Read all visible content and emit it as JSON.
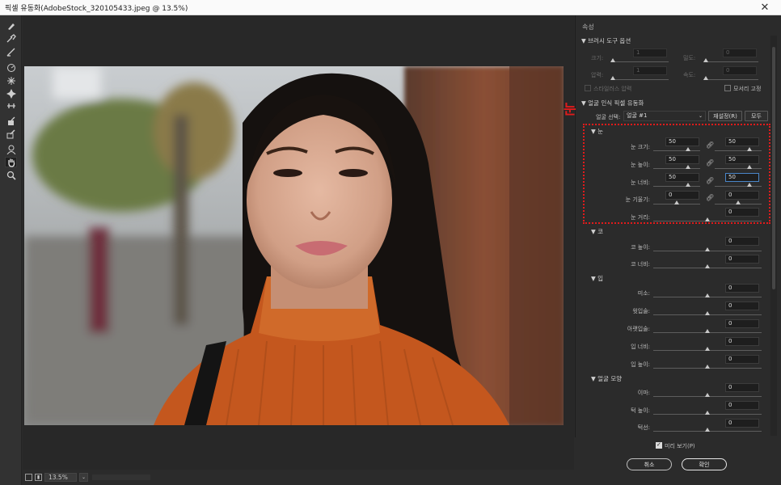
{
  "window": {
    "title": "픽셀 유동화(AdobeStock_320105433.jpeg @ 13.5%)",
    "close_glyph": "✕"
  },
  "tools": [
    "forward-warp-icon",
    "reconstruct-icon",
    "smooth-icon",
    "twirl-icon",
    "pucker-icon",
    "bloat-icon",
    "push-left-icon",
    "freeze-mask-icon",
    "thaw-mask-icon",
    "face-tool-icon",
    "hand-icon",
    "zoom-icon"
  ],
  "status": {
    "zoom": "13.5%"
  },
  "panel": {
    "header": "속성",
    "brush": {
      "title": "▼ 브러시 도구 옵션",
      "size_label": "크기:",
      "size_value": "1",
      "density_label": "밀도:",
      "density_value": "0",
      "pressure_label": "압력:",
      "pressure_value": "1",
      "rate_label": "속도:",
      "rate_value": "0",
      "stylus_label": "스타일러스 압력",
      "pin_edges_label": "모서리 고정"
    },
    "face": {
      "title": "▼ 얼굴 인식 픽셀 유동화",
      "select_label": "얼굴 선택:",
      "select_value": "얼굴 #1",
      "reset_label": "재설정(R)",
      "all_label": "모두",
      "eyes": {
        "title": "▼ 눈",
        "size_label": "눈 크기:",
        "size_left": "50",
        "size_right": "50",
        "height_label": "눈 높이:",
        "height_left": "50",
        "height_right": "50",
        "width_label": "눈 너비:",
        "width_left": "50",
        "width_right": "50",
        "tilt_label": "눈 기울기:",
        "tilt_left": "0",
        "tilt_right": "0",
        "distance_label": "눈 거리:",
        "distance_value": "0"
      },
      "nose": {
        "title": "▼ 코",
        "height_label": "코 높이:",
        "height_value": "0",
        "width_label": "코 너비:",
        "width_value": "0"
      },
      "mouth": {
        "title": "▼ 입",
        "smile_label": "미소:",
        "smile_value": "0",
        "upper_label": "윗입술:",
        "upper_value": "0",
        "lower_label": "아랫입술:",
        "lower_value": "0",
        "width_label": "입 너비:",
        "width_value": "0",
        "height_label": "입 높이:",
        "height_value": "0"
      },
      "shape": {
        "title": "▼ 얼굴 모양",
        "forehead_label": "이마:",
        "forehead_value": "0",
        "chin_label": "턱 높이:",
        "chin_value": "0",
        "jaw_label": "턱선:",
        "jaw_value": "0"
      }
    },
    "preview_label": "미리 보기(P)",
    "cancel_label": "취소",
    "ok_label": "확인"
  },
  "annotation": {
    "text": "눈",
    "color": "#e01b1b"
  }
}
